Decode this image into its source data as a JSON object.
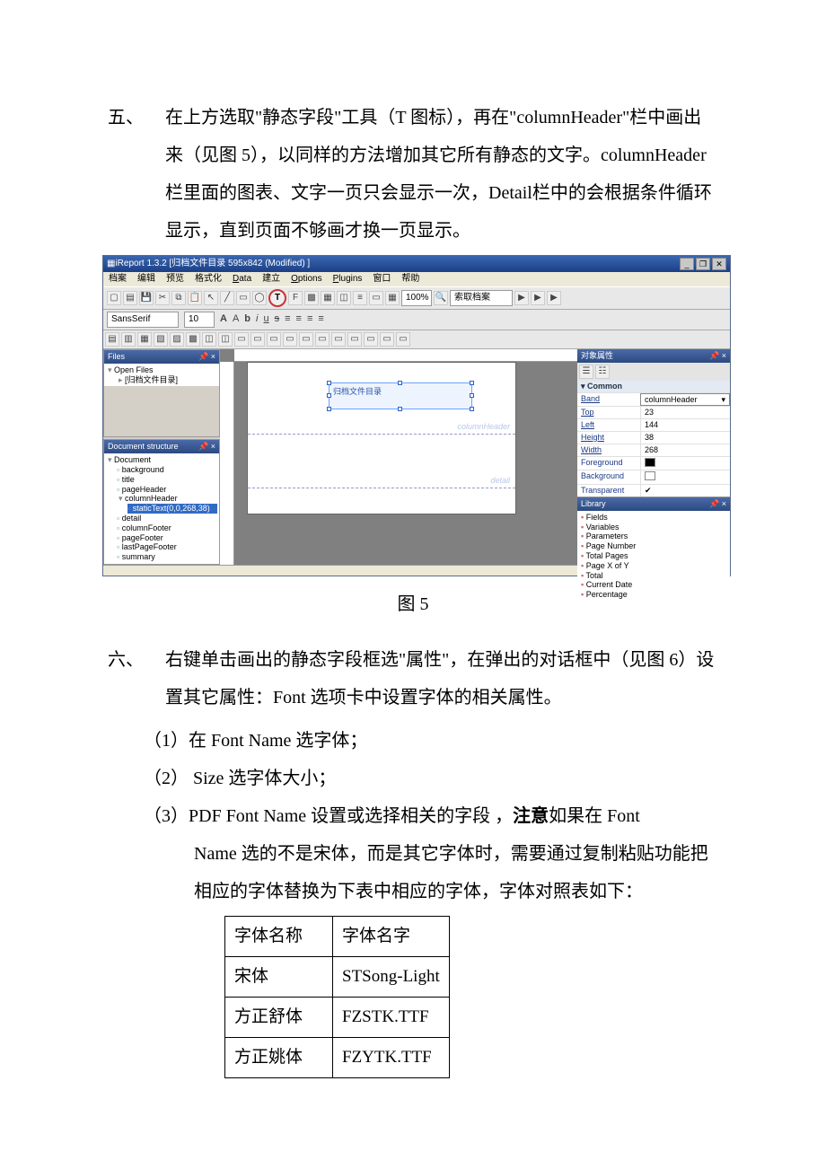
{
  "sections": {
    "five": {
      "num": "五、",
      "text": "在上方选取\"静态字段\"工具（T 图标），再在\"columnHeader\"栏中画出来（见图 5），以同样的方法增加其它所有静态的文字。columnHeader 栏里面的图表、文字一页只会显示一次，Detail栏中的会根据条件循环显示，直到页面不够画才换一页显示。"
    },
    "six": {
      "num": "六、",
      "text": "右键单击画出的静态字段框选\"属性\"，在弹出的对话框中（见图 6）设置其它属性：Font 选项卡中设置字体的相关属性。",
      "items": [
        "（1）在 Font Name 选字体；",
        "（2） Size 选字体大小；",
        "（3）PDF Font Name 设置或选择相关的字段 ，"
      ],
      "item3_note": "注意",
      "item3_tail": "如果在 Font Name 选的不是宋体，而是其它字体时，需要通过复制粘贴功能把相应的字体替换为下表中相应的字体，字体对照表如下："
    }
  },
  "figcap": "图 5",
  "font_table": {
    "header": [
      "字体名称",
      "字体名字"
    ],
    "rows": [
      [
        "宋体",
        "STSong-Light"
      ],
      [
        "方正舒体",
        "FZSTK.TTF"
      ],
      [
        "方正姚体",
        "FZYTK.TTF"
      ]
    ]
  },
  "app": {
    "title": "iReport 1.3.2  [归档文件目录  595x842 (Modified) ]",
    "menubar": [
      "档案",
      "编辑",
      "预览",
      "格式化",
      "Data",
      "建立",
      "Options",
      "Plugins",
      "窗口",
      "帮助"
    ],
    "font_selector": "SansSerif",
    "font_size": "10",
    "zoom": "100%",
    "search_placeholder": "索取档案",
    "panels": {
      "files": {
        "title": "Files",
        "root": "Open Files",
        "item": "[归档文件目录]"
      },
      "structure": {
        "title": "Document structure",
        "items": [
          "Document",
          "background",
          "title",
          "pageHeader",
          "columnHeader",
          "detail",
          "columnFooter",
          "pageFooter",
          "lastPageFooter",
          "summary"
        ],
        "selected_child": "staticText(0,0,268,38)"
      },
      "canvas": {
        "static_text": "归档文件目录",
        "bands": {
          "columnHeader": "columnHeader",
          "detail": "detail"
        }
      },
      "props": {
        "title": "对象属性",
        "category": "Common",
        "rows": [
          [
            "Band",
            "columnHeader"
          ],
          [
            "Top",
            "23"
          ],
          [
            "Left",
            "144"
          ],
          [
            "Height",
            "38"
          ],
          [
            "Width",
            "268"
          ],
          [
            "Foreground",
            ""
          ],
          [
            "Background",
            ""
          ],
          [
            "Transparent",
            "✔"
          ]
        ]
      },
      "library": {
        "title": "Library",
        "items": [
          "Fields",
          "Variables",
          "Parameters",
          "Page Number",
          "Total Pages",
          "Page X of Y",
          "Total",
          "Current Date",
          "Percentage"
        ]
      }
    }
  }
}
